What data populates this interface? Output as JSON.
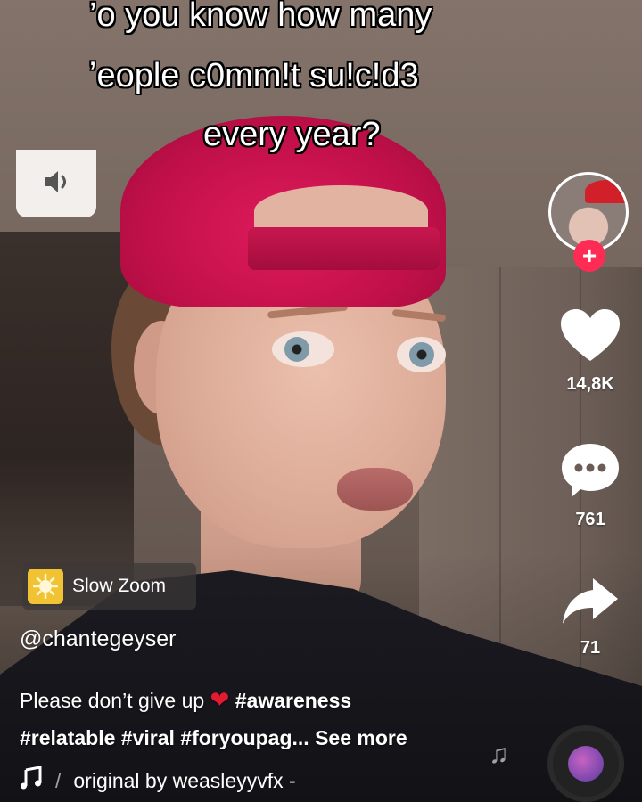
{
  "caption": {
    "line1": "’o you know how many",
    "line2": "ʼeople c0mm!t su!c!d3",
    "line3": "every year?"
  },
  "icons": {
    "volume": "speaker-icon",
    "like": "heart-icon",
    "comment": "comment-bubble-icon",
    "share": "share-arrow-icon",
    "effect": "slow-zoom-effect-icon",
    "music": "music-note-icon"
  },
  "creator": {
    "follow_symbol": "+"
  },
  "actions": {
    "likes": "14,8K",
    "comments": "761",
    "shares": "71"
  },
  "effect": {
    "label": "Slow Zoom"
  },
  "post": {
    "username": "@chantegeyser",
    "text": "Please don’t give up",
    "emoji": "❤",
    "tag1": "#awareness",
    "tags_line": "#relatable #viral #foryoupag...",
    "see_more": "See more"
  },
  "music": {
    "label": "original by weasleyyvfx -"
  },
  "colors": {
    "accent_pink": "#fe2c55",
    "cap_red": "#d01452",
    "heart_red": "#e31b30",
    "effect_yellow": "#f1c232"
  }
}
